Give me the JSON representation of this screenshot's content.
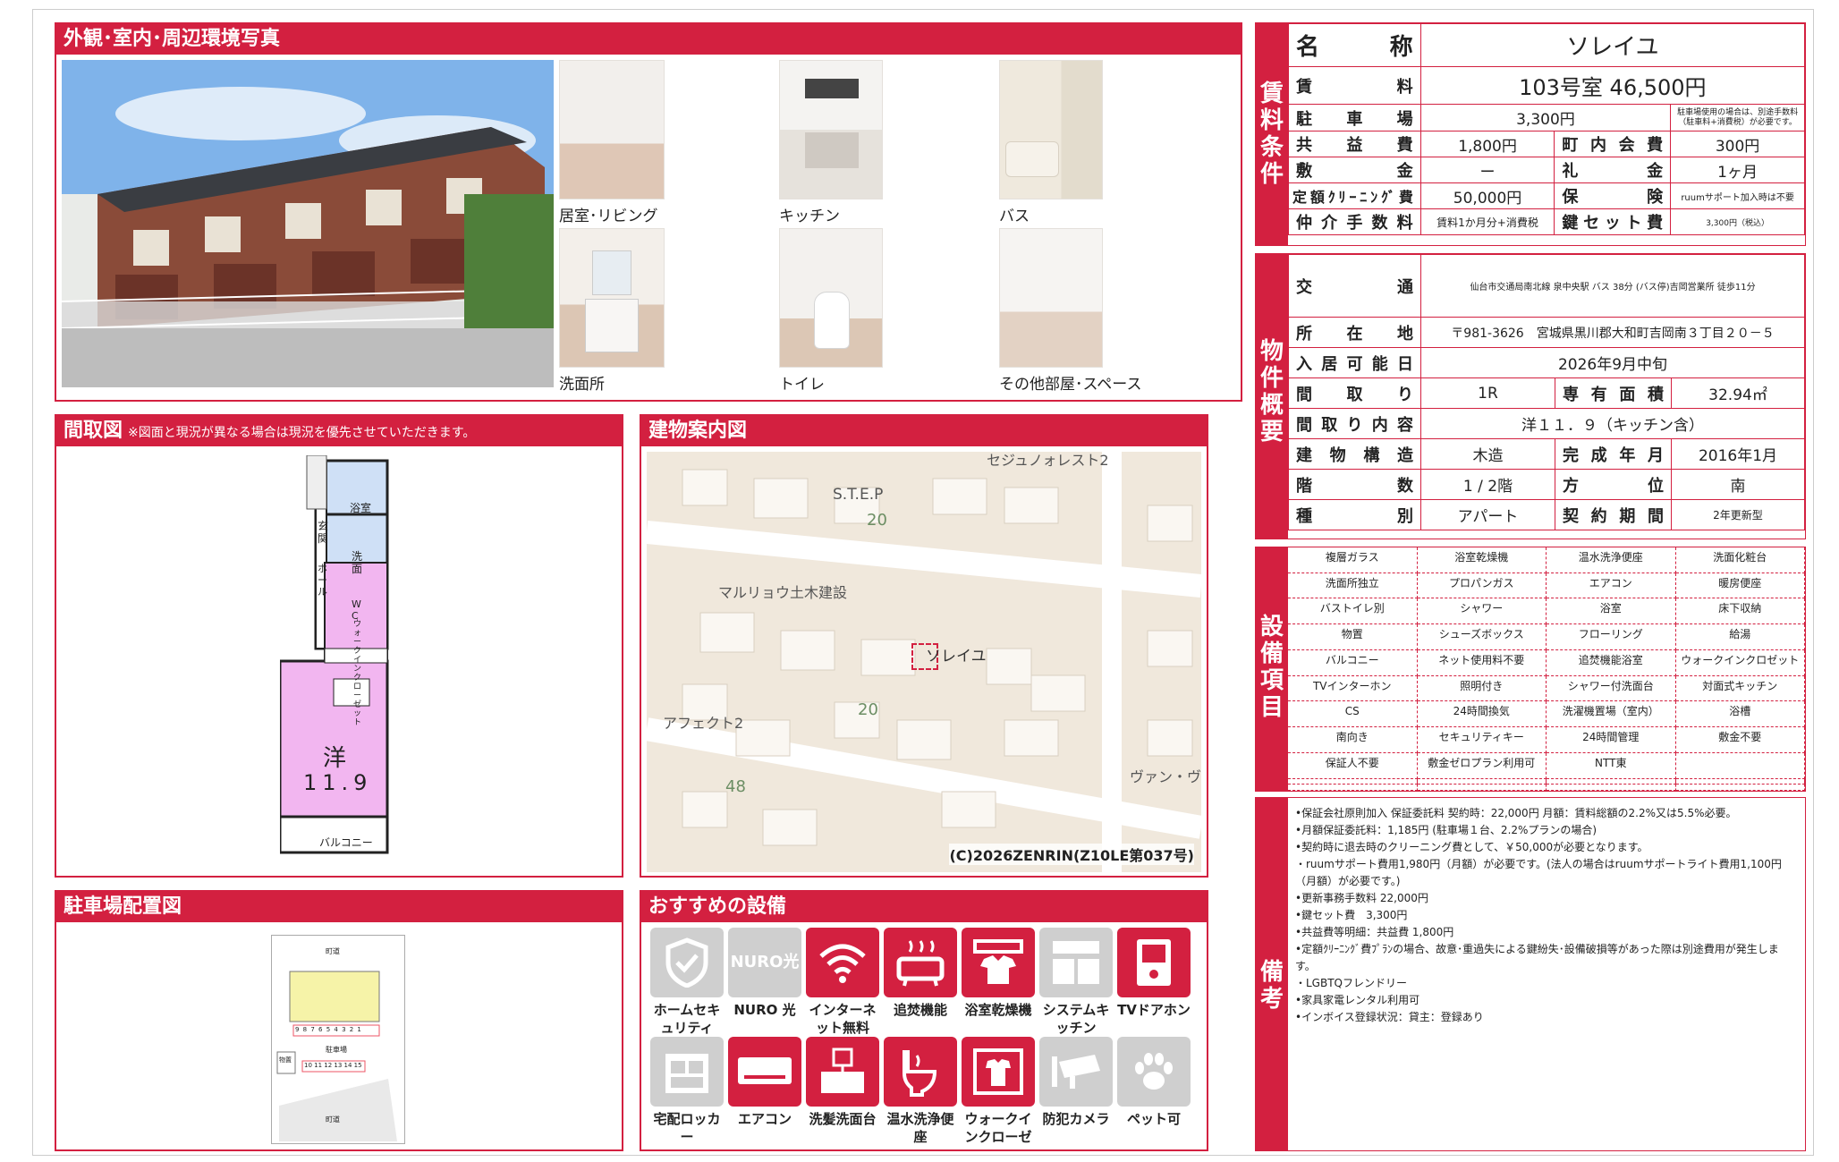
{
  "photos": {
    "title": "外観･室内･周辺環境写真",
    "captions": [
      "居室･リビング",
      "キッチン",
      "バス",
      "洗面所",
      "トイレ",
      "その他部屋･スペース"
    ]
  },
  "floorplan": {
    "title": "間取図",
    "note": "※図面と現況が異なる場合は現況を優先させていただきます。",
    "labels": {
      "bath": "浴室",
      "entrance": "玄関",
      "wash": "洗面",
      "hall": "ホール",
      "wc": "WC",
      "closet": "ウォークインクローゼット",
      "room": "洋",
      "size": "11.9",
      "balcony": "バルコニー"
    }
  },
  "map": {
    "title": "建物案内図",
    "labels": [
      "セジュノォレスト2",
      "S.T.E.P",
      "20",
      "マルリョウ土木建設",
      "ソレイユ",
      "アフェクト2",
      "20",
      "48",
      "ヴァン・ヴ"
    ],
    "copyright": "(C)2026ZENRIN(Z10LE第037号)"
  },
  "parking": {
    "title": "駐車場配置図",
    "labels": {
      "road": "町道",
      "lot": "駐車場",
      "building": "物置",
      "numbers1": "9 8 7 6 5 4 3 2 1",
      "numbers2": "10 11 12 13 14 15"
    }
  },
  "recommended": {
    "title": "おすすめの設備",
    "items": [
      {
        "label": "ホームセキュリティ",
        "active": false,
        "icon": "shield-icon"
      },
      {
        "label": "NURO 光",
        "active": false,
        "icon": "nuro-icon",
        "badge": "NURO光"
      },
      {
        "label": "インターネット無料",
        "active": true,
        "icon": "wifi-icon"
      },
      {
        "label": "追焚機能",
        "active": true,
        "icon": "bathtub-icon"
      },
      {
        "label": "浴室乾燥機",
        "active": true,
        "icon": "bath-dryer-icon"
      },
      {
        "label": "システムキッチン",
        "active": false,
        "icon": "kitchen-icon"
      },
      {
        "label": "TVドアホン",
        "active": true,
        "icon": "intercom-icon"
      },
      {
        "label": "宅配ロッカー",
        "active": false,
        "icon": "locker-icon"
      },
      {
        "label": "エアコン",
        "active": true,
        "icon": "aircon-icon"
      },
      {
        "label": "洗髪洗面台",
        "active": true,
        "icon": "washbasin-icon"
      },
      {
        "label": "温水洗浄便座",
        "active": true,
        "icon": "toilet-icon"
      },
      {
        "label": "ウォークインクローゼット",
        "active": true,
        "icon": "closet-icon"
      },
      {
        "label": "防犯カメラ",
        "active": false,
        "icon": "camera-icon"
      },
      {
        "label": "ペット可",
        "active": false,
        "icon": "paw-icon"
      }
    ]
  },
  "rent": {
    "section_label": "賃料条件",
    "name_label": "名称",
    "name": "ソレイユ",
    "rent_label": "賃料",
    "rent": "103号室 46,500円",
    "parking_label": "駐車場",
    "parking": "3,300円",
    "parking_note": "駐車場使用の場合は、別途手数料（駐車料+消費税）が必要です。",
    "common_label": "共益費",
    "common": "1,800円",
    "town_label": "町内会費",
    "town": "300円",
    "deposit_label": "敷金",
    "deposit": "ー",
    "key_money_label": "礼金",
    "key_money": "1ヶ月",
    "cleaning_label": "定額ｸﾘｰﾆﾝｸﾞ費",
    "cleaning": "50,000円",
    "insurance_label": "保険",
    "insurance": "ruumサポート加入時は不要",
    "brokerage_label": "仲介手数料",
    "brokerage": "賃料1か月分+消費税",
    "keyset_label": "鍵セット費",
    "keyset": "3,300円（税込）"
  },
  "overview": {
    "section_label": "物件概要",
    "access_label": "交通",
    "access": "仙台市交通局南北線 泉中央駅 バス 38分 (バス停)吉岡営業所 徒歩11分",
    "address_label": "所在地",
    "address": "〒981-3626　宮城県黒川郡大和町吉岡南３丁目２０－５",
    "move_in_label": "入居可能日",
    "move_in": "2026年9月中旬",
    "layout_label": "間取り",
    "layout": "1R",
    "area_label": "専有面積",
    "area": "32.94㎡",
    "layout_detail_label": "間取り内容",
    "layout_detail": "洋１１．９（キッチン含）",
    "structure_label": "建物構造",
    "structure": "木造",
    "built_label": "完成年月",
    "built": "2016年1月",
    "floor_label": "階数",
    "floor": "1 / 2階",
    "direction_label": "方位",
    "direction": "南",
    "type_label": "種別",
    "type": "アパート",
    "contract_label": "契約期間",
    "contract": "2年更新型"
  },
  "equipment": {
    "section_label": "設備項目",
    "items": [
      "複層ガラス",
      "浴室乾燥機",
      "温水洗浄便座",
      "洗面化粧台",
      "洗面所独立",
      "プロパンガス",
      "エアコン",
      "暖房便座",
      "バストイレ別",
      "シャワー",
      "浴室",
      "床下収納",
      "物置",
      "シューズボックス",
      "フローリング",
      "給湯",
      "バルコニー",
      "ネット使用料不要",
      "追焚機能浴室",
      "ウォークインクロゼット",
      "TVインターホン",
      "照明付き",
      "シャワー付洗面台",
      "対面式キッチン",
      "CS",
      "24時間換気",
      "洗濯機置場（室内）",
      "浴槽",
      "南向き",
      "セキュリティキー",
      "24時間管理",
      "敷金不要",
      "保証人不要",
      "敷金ゼロプラン利用可",
      "NTT東",
      "",
      "",
      "",
      "",
      "",
      "",
      "",
      "",
      ""
    ]
  },
  "remarks": {
    "section_label": "備考",
    "lines": [
      "•保証会社原則加入 保証委託料 契約時：22,000円 月額：賃料総額の2.2%又は5.5%必要。",
      "•月額保証委託料：1,185円 (駐車場１台、2.2%プランの場合)",
      "•契約時に退去時のクリーニング費として、￥50,000が必要となります。",
      "・ruumサポート費用1,980円（月額）が必要です。(法人の場合はruumサポートライト費用1,100円（月額）が必要です。)",
      "•更新事務手数料 22,000円",
      "•鍵セット費　3,300円",
      "•共益費等明細：共益費 1,800円",
      "•定額ｸﾘｰﾆﾝｸﾞ費ﾌﾟﾗﾝの場合、故意･重過失による鍵紛失･設備破損等があった際は別途費用が発生します。",
      "・LGBTQフレンドリー",
      "•家具家電レンタル利用可",
      "•インボイス登録状況：貸主：登録あり"
    ]
  },
  "colors": {
    "accent": "#d32040",
    "floor_pink": "#f2b6f0",
    "floor_blue": "#cfe0f6",
    "map_bg": "#f0e8dc"
  }
}
